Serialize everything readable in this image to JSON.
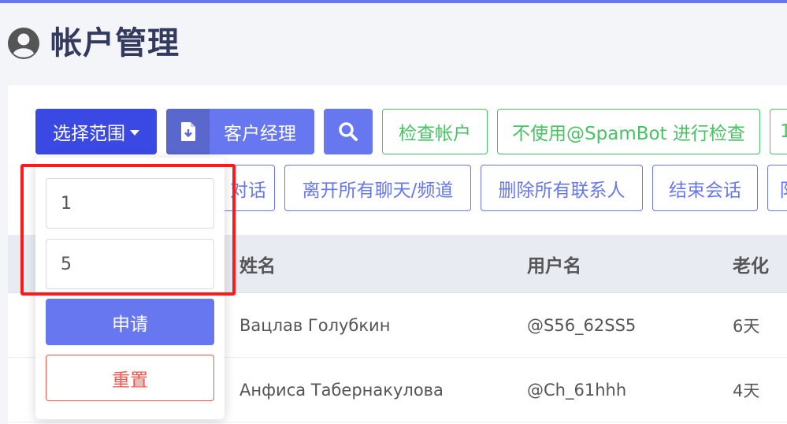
{
  "page": {
    "title": "帐户管理"
  },
  "toolbar": {
    "select_range_label": "选择范围",
    "account_manager_label": "客户经理",
    "check_accounts_label": "检查帐户",
    "spambot_check_label": "不使用@SpamBot 进行检查",
    "cut_label_1": "1",
    "row2": {
      "dialog_label": "对话",
      "leave_all_label": "离开所有聊天/频道",
      "delete_contacts_label": "删除所有联系人",
      "end_session_label": "结束会话",
      "cut_label_2": "阝"
    }
  },
  "table": {
    "headers": {
      "name": "姓名",
      "username": "用户名",
      "aging": "老化"
    },
    "rows": [
      {
        "name": "Вацлав Голубкин",
        "username": "@S56_62SS5",
        "aging": "6天"
      },
      {
        "name": "Анфиса Табернакулова",
        "username": "@Ch_61hhh",
        "aging": "4天"
      }
    ]
  },
  "range_dropdown": {
    "from_value": "1",
    "to_value": "5",
    "apply_label": "申请",
    "reset_label": "重置"
  },
  "colors": {
    "primary": "#6777ef",
    "primary_dark": "#3b49e4",
    "success": "#47c363",
    "danger": "#fc544b",
    "highlight": "#ff1a1a"
  },
  "icons": [
    "user-circle-icon",
    "caret-down-icon",
    "file-download-icon",
    "search-icon"
  ]
}
